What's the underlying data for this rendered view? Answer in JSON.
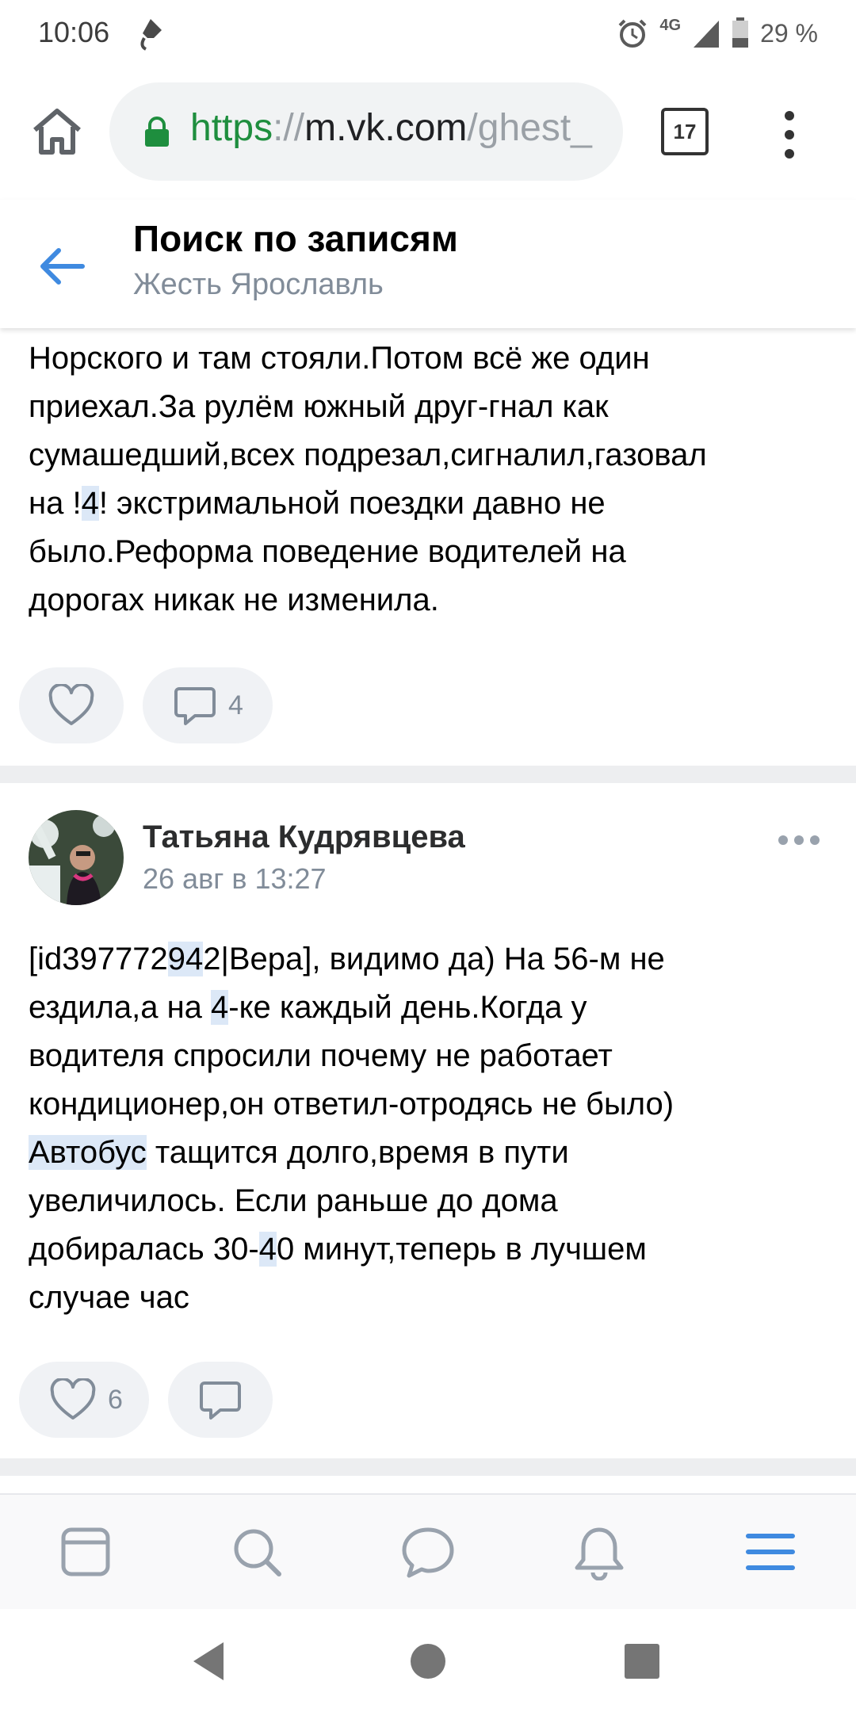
{
  "status_bar": {
    "time": "10:06",
    "network": "4G",
    "battery": "29 %"
  },
  "browser": {
    "url_scheme": "https",
    "url_sep": "://",
    "url_host": "m.vk.com",
    "url_path": "/ghest_",
    "tab_count": "17",
    "icons": [
      "home-icon",
      "lock-icon",
      "tabs-icon",
      "more-vert-icon"
    ]
  },
  "header": {
    "title": "Поиск по записям",
    "subtitle": "Жесть Ярославль"
  },
  "post1": {
    "line1": "Норского и там стояли.Потом всё же один",
    "line2": "приехал.За рулём южный друг-гнал как",
    "line3": "сумашедший,всех подрезал,сигналил,газовал",
    "line4_a": "на !",
    "line4_hl": "4",
    "line4_b": "! экстримальной поездки давно не",
    "line5": "было.Реформа поведение водителей на",
    "line6": "дорогах никак не изменила.",
    "likes": "",
    "comments": "4"
  },
  "post2": {
    "author": "Татьяна Кудрявцева",
    "date": "26 авг в 13:27",
    "t1_a": "[id397772",
    "t1_hl": "94",
    "t1_b": "2|Вера], видимо да) На 56-м не",
    "t2_a": "ездила,а на ",
    "t2_hl": "4",
    "t2_b": "-ке каждый день.Когда у",
    "t3": "водителя спросили почему не работает",
    "t4": "кондиционер,он ответил-отродясь не было)",
    "t5_hl": "Автобус",
    "t5_b": " тащится долго,время в пути",
    "t6": "увеличилось. Если раньше до дома",
    "t7_a": "добиралась 30-",
    "t7_hl": "4",
    "t7_b": "0 минут,теперь в лучшем",
    "t8": "случае час",
    "likes": "6",
    "comments": ""
  },
  "colors": {
    "accent": "#2a5885",
    "nav_active": "#3f8ae0",
    "secure": "#1e8e3e",
    "highlight": "#dce8f7"
  }
}
